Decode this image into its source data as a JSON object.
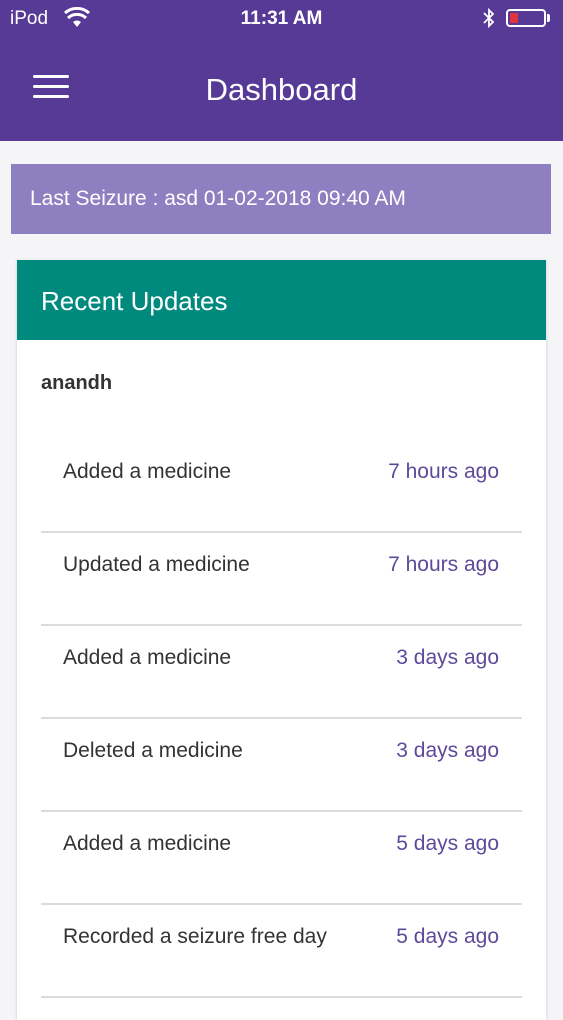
{
  "status_bar": {
    "carrier": "iPod",
    "time": "11:31 AM"
  },
  "header": {
    "title": "Dashboard",
    "menu_icon": "hamburger-menu-icon"
  },
  "last_seizure": {
    "text": "Last Seizure : asd 01-02-2018 09:40 AM"
  },
  "recent_updates": {
    "title": "Recent Updates",
    "user": "anandh",
    "items": [
      {
        "action": "Added a medicine",
        "when": "7 hours ago"
      },
      {
        "action": "Updated a medicine",
        "when": "7 hours ago"
      },
      {
        "action": "Added a medicine",
        "when": "3 days ago"
      },
      {
        "action": "Deleted a medicine",
        "when": "3 days ago"
      },
      {
        "action": "Added a medicine",
        "when": "5 days ago"
      },
      {
        "action": "Recorded a seizure free day",
        "when": "5 days ago"
      }
    ]
  },
  "colors": {
    "header": "#563a96",
    "last_seizure_banner": "#8e80c0",
    "card_header": "#008a7e",
    "time_text": "#5d4a9a"
  }
}
